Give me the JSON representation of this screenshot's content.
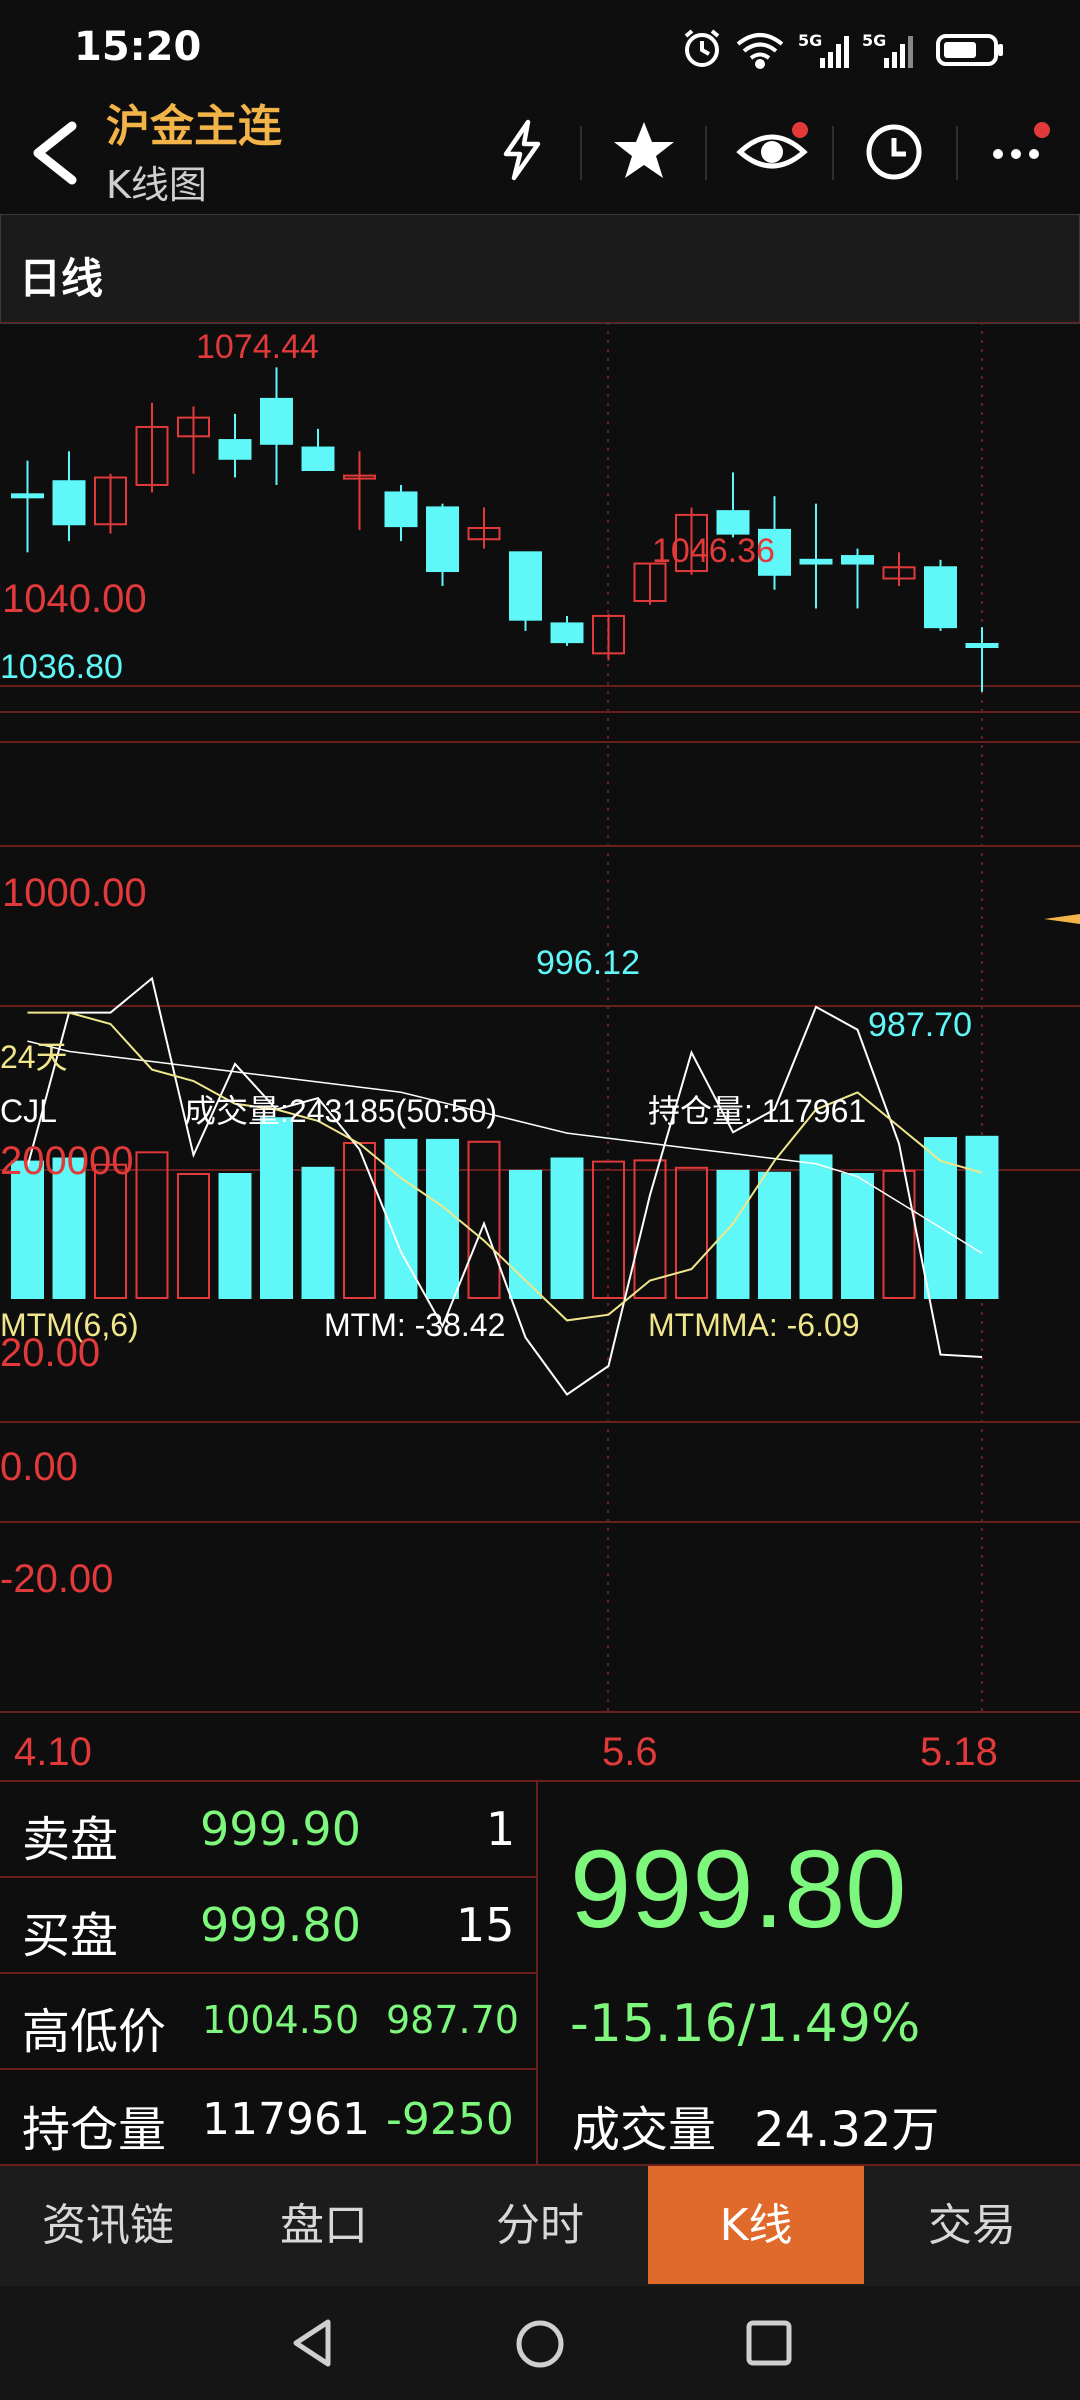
{
  "status_bar": {
    "time": "15:20",
    "signal1": "5G",
    "signal2": "5G"
  },
  "header": {
    "title": "沪金主连",
    "subtitle": "K线图",
    "icons": [
      "back-arrow-icon",
      "lightning-icon",
      "star-icon",
      "eye-icon",
      "clock-icon",
      "more-icon"
    ]
  },
  "section": {
    "label": "日线"
  },
  "chart": {
    "price_labels": {
      "high_main": "1074.44",
      "high_second": "1046.36",
      "low_main": "996.12",
      "low_last": "987.70",
      "left_value": "1036.80"
    },
    "price_axis": {
      "top": "1040.00",
      "bottom": "1000.00"
    },
    "period_label": "24天",
    "volume_panel": {
      "name": "CJL",
      "volume_label": "成交量:243185(50:50)",
      "oi_label": "持仓量: 117961",
      "axis": "200000"
    },
    "mtm_panel": {
      "name": "MTM(6,6)",
      "mtm_label": "MTM: -38.42",
      "mtmma_label": "MTMMA: -6.09",
      "axis": [
        "20.00",
        "0.00",
        "-20.00"
      ]
    },
    "dates": [
      "4.10",
      "5.6",
      "5.18"
    ],
    "colors": {
      "up": "#e23a3a",
      "down": "#5ff7f7",
      "ma": "#f0e68c",
      "grid": "#6a1f1f",
      "mtm": "#ffffff"
    }
  },
  "chart_data": {
    "type": "candlestick",
    "x_ticks": [
      "4.10",
      "5.6",
      "5.18"
    ],
    "ylim": [
      985,
      1078
    ],
    "candles": [
      {
        "o": 1040.5,
        "h": 1049.5,
        "l": 1025.0,
        "c": 1040.0
      },
      {
        "o": 1044.0,
        "h": 1052.0,
        "l": 1028.0,
        "c": 1032.5
      },
      {
        "o": 1032.5,
        "h": 1046.0,
        "l": 1030.0,
        "c": 1045.0
      },
      {
        "o": 1043.0,
        "h": 1065.0,
        "l": 1041.0,
        "c": 1058.5
      },
      {
        "o": 1056.0,
        "h": 1064.0,
        "l": 1046.0,
        "c": 1061.0
      },
      {
        "o": 1055.0,
        "h": 1062.0,
        "l": 1045.0,
        "c": 1050.0
      },
      {
        "o": 1066.0,
        "h": 1074.44,
        "l": 1043.0,
        "c": 1054.0
      },
      {
        "o": 1053.0,
        "h": 1058.0,
        "l": 1047.0,
        "c": 1047.0
      },
      {
        "o": 1045.0,
        "h": 1052.0,
        "l": 1031.0,
        "c": 1045.5
      },
      {
        "o": 1041.0,
        "h": 1043.0,
        "l": 1028.0,
        "c": 1032.0
      },
      {
        "o": 1037.0,
        "h": 1038.0,
        "l": 1016.0,
        "c": 1020.0
      },
      {
        "o": 1028.5,
        "h": 1037.0,
        "l": 1026.0,
        "c": 1031.5
      },
      {
        "o": 1025.0,
        "h": 1025.0,
        "l": 1004.0,
        "c": 1007.0
      },
      {
        "o": 1006.0,
        "h": 1008.0,
        "l": 1000.0,
        "c": 1001.0
      },
      {
        "o": 998.0,
        "h": 1008.5,
        "l": 996.12,
        "c": 1008.0
      },
      {
        "o": 1012.0,
        "h": 1022.0,
        "l": 1011.0,
        "c": 1022.0
      },
      {
        "o": 1020.0,
        "h": 1037.0,
        "l": 1019.0,
        "c": 1035.0
      },
      {
        "o": 1036.0,
        "h": 1046.36,
        "l": 1029.0,
        "c": 1030.0
      },
      {
        "o": 1031.0,
        "h": 1040.0,
        "l": 1015.0,
        "c": 1019.0
      },
      {
        "o": 1023.0,
        "h": 1038.0,
        "l": 1010.0,
        "c": 1022.0
      },
      {
        "o": 1024.0,
        "h": 1026.0,
        "l": 1010.0,
        "c": 1022.0
      },
      {
        "o": 1018.0,
        "h": 1025.0,
        "l": 1016.0,
        "c": 1021.0
      },
      {
        "o": 1021.0,
        "h": 1023.0,
        "l": 1004.0,
        "c": 1005.0
      },
      {
        "o": 1000.5,
        "h": 1005.0,
        "l": 987.7,
        "c": 999.8
      }
    ],
    "volume": [
      220000,
      225000,
      215000,
      235000,
      200000,
      200000,
      290000,
      210000,
      250000,
      255000,
      255000,
      252000,
      205000,
      225000,
      220000,
      222000,
      210000,
      205000,
      202000,
      230000,
      200000,
      205000,
      258000,
      260000
    ],
    "oi": [
      268000,
      264000,
      262000,
      260000,
      258000,
      256000,
      254000,
      252000,
      250000,
      248000,
      244000,
      240000,
      236000,
      232000,
      230000,
      228000,
      226000,
      224000,
      222000,
      220000,
      215000,
      205000,
      195000,
      185000
    ],
    "mtm": [
      -5,
      22,
      22,
      28,
      -3,
      13,
      5,
      7,
      -2,
      -20,
      -33,
      -15,
      -35,
      -45,
      -40,
      -10,
      15,
      1,
      5,
      23,
      19,
      -1,
      -38,
      -38.42
    ],
    "mtmma": [
      22,
      22,
      20,
      12,
      10,
      6,
      5,
      3,
      -1,
      -7,
      -12,
      -18,
      -25,
      -32,
      -31,
      -25,
      -23,
      -15,
      -4,
      5,
      8,
      2,
      -4,
      -6.09
    ]
  },
  "quotes": {
    "sell": {
      "label": "卖盘",
      "price": "999.90",
      "qty": "1"
    },
    "buy": {
      "label": "买盘",
      "price": "999.80",
      "qty": "15"
    },
    "highlow": {
      "label": "高低价",
      "high": "1004.50",
      "low": "987.70"
    },
    "oi": {
      "label": "持仓量",
      "value": "117961",
      "change": "-9250"
    },
    "last_price": "999.80",
    "change": "-15.16/1.49%",
    "volume": {
      "label": "成交量",
      "value": "24.32万"
    }
  },
  "tabs": [
    {
      "label": "资讯链"
    },
    {
      "label": "盘口"
    },
    {
      "label": "分时"
    },
    {
      "label": "K线"
    },
    {
      "label": "交易"
    }
  ],
  "nav": {
    "icons": [
      "back-triangle-icon",
      "home-circle-icon",
      "recents-square-icon"
    ]
  }
}
